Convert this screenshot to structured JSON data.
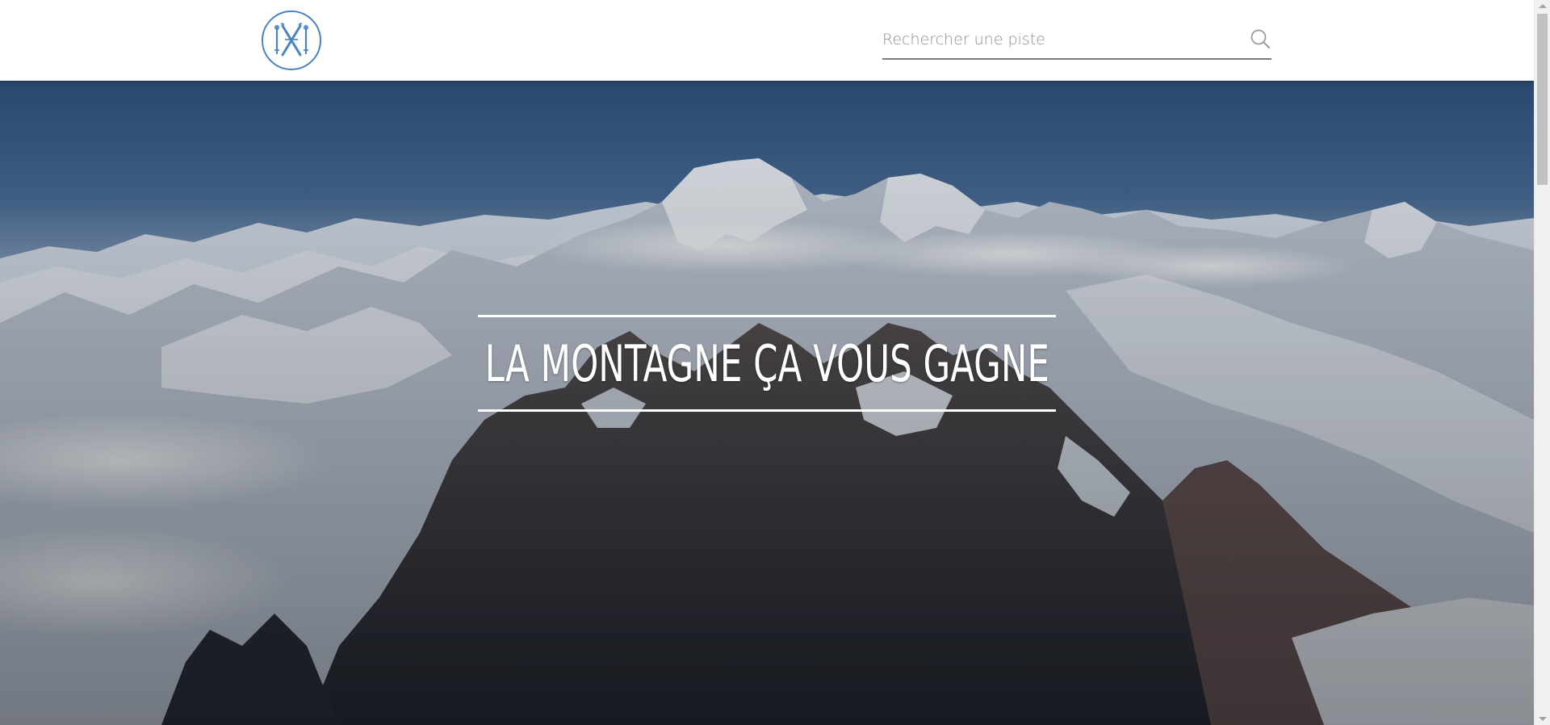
{
  "header": {
    "logo_icon": "ski-crossed-poles-logo-icon",
    "brand_color": "#4a82c3",
    "search": {
      "placeholder": "Rechercher une piste",
      "value": "",
      "icon": "search-icon"
    }
  },
  "hero": {
    "title": "LA MONTAGNE ÇA VOUS GAGNE",
    "background": "snowy-mountain-range-photo"
  }
}
